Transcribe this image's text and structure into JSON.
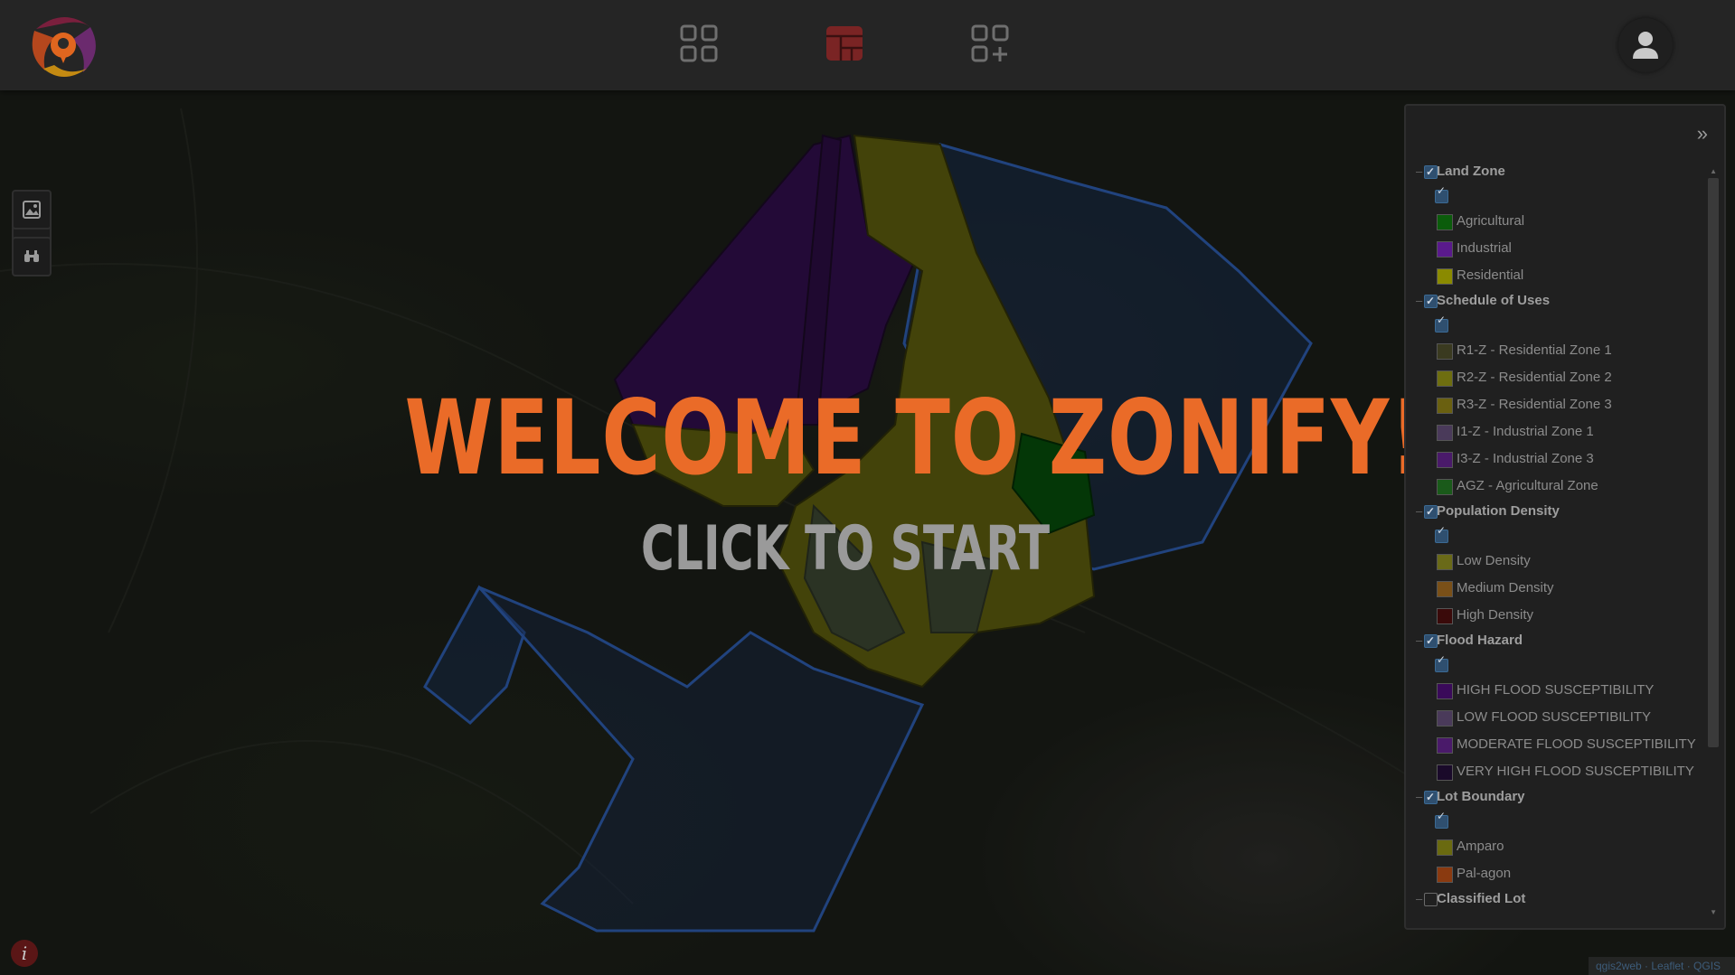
{
  "header": {
    "logo_icon": "zonify-logo-icon",
    "nav": [
      {
        "name": "dashboard-grid-icon",
        "active": false
      },
      {
        "name": "zoning-map-icon",
        "active": true
      },
      {
        "name": "add-module-icon",
        "active": false
      }
    ],
    "user_icon": "user-account-icon"
  },
  "map_controls": {
    "zoom_in": "+",
    "zoom_out": "−",
    "tools": [
      "basemap-image-icon",
      "binoculars-icon"
    ],
    "info": "i"
  },
  "welcome": {
    "title": "WELCOME TO ZONIFY!",
    "subtitle": "CLICK TO START"
  },
  "layers_panel": {
    "collapse_label": "»",
    "groups": [
      {
        "label": "Land Zone",
        "checked": true,
        "items": [
          {
            "label": "Agricultural",
            "color": "#0b5c0b"
          },
          {
            "label": "Industrial",
            "color": "#5a1a8c"
          },
          {
            "label": "Residential",
            "color": "#8a8a00"
          }
        ]
      },
      {
        "label": "Schedule of Uses",
        "checked": true,
        "items": [
          {
            "label": "R1-Z - Residential Zone 1",
            "color": "#3a3a20"
          },
          {
            "label": "R2-Z - Residential Zone 2",
            "color": "#6e6e10"
          },
          {
            "label": "R3-Z - Residential Zone 3",
            "color": "#6a6010"
          },
          {
            "label": "I1-Z - Industrial Zone 1",
            "color": "#4a3a5a"
          },
          {
            "label": "I3-Z - Industrial Zone 3",
            "color": "#4a1a6a"
          },
          {
            "label": "AGZ - Agricultural Zone",
            "color": "#1a5a1a"
          }
        ]
      },
      {
        "label": "Population Density",
        "checked": true,
        "items": [
          {
            "label": "Low Density",
            "color": "#6a6a18"
          },
          {
            "label": "Medium Density",
            "color": "#7a5018"
          },
          {
            "label": "High Density",
            "color": "#3a0a0a"
          }
        ]
      },
      {
        "label": "Flood Hazard",
        "checked": true,
        "items": [
          {
            "label": "HIGH FLOOD SUSCEPTIBILITY",
            "color": "#3a0a5a"
          },
          {
            "label": "LOW FLOOD SUSCEPTIBILITY",
            "color": "#4a3a5a"
          },
          {
            "label": "MODERATE FLOOD SUSCEPTIBILITY",
            "color": "#4a1a6a"
          },
          {
            "label": "VERY HIGH FLOOD SUSCEPTIBILITY",
            "color": "#1a0a2a"
          }
        ]
      },
      {
        "label": "Lot Boundary",
        "checked": true,
        "items": [
          {
            "label": "Amparo",
            "color": "#6a6a10"
          },
          {
            "label": "Pal-agon",
            "color": "#8a3a10"
          }
        ]
      },
      {
        "label": "Classified Lot",
        "checked": false,
        "items": []
      }
    ]
  },
  "attribution": "qgis2web · Leaflet · QGIS"
}
